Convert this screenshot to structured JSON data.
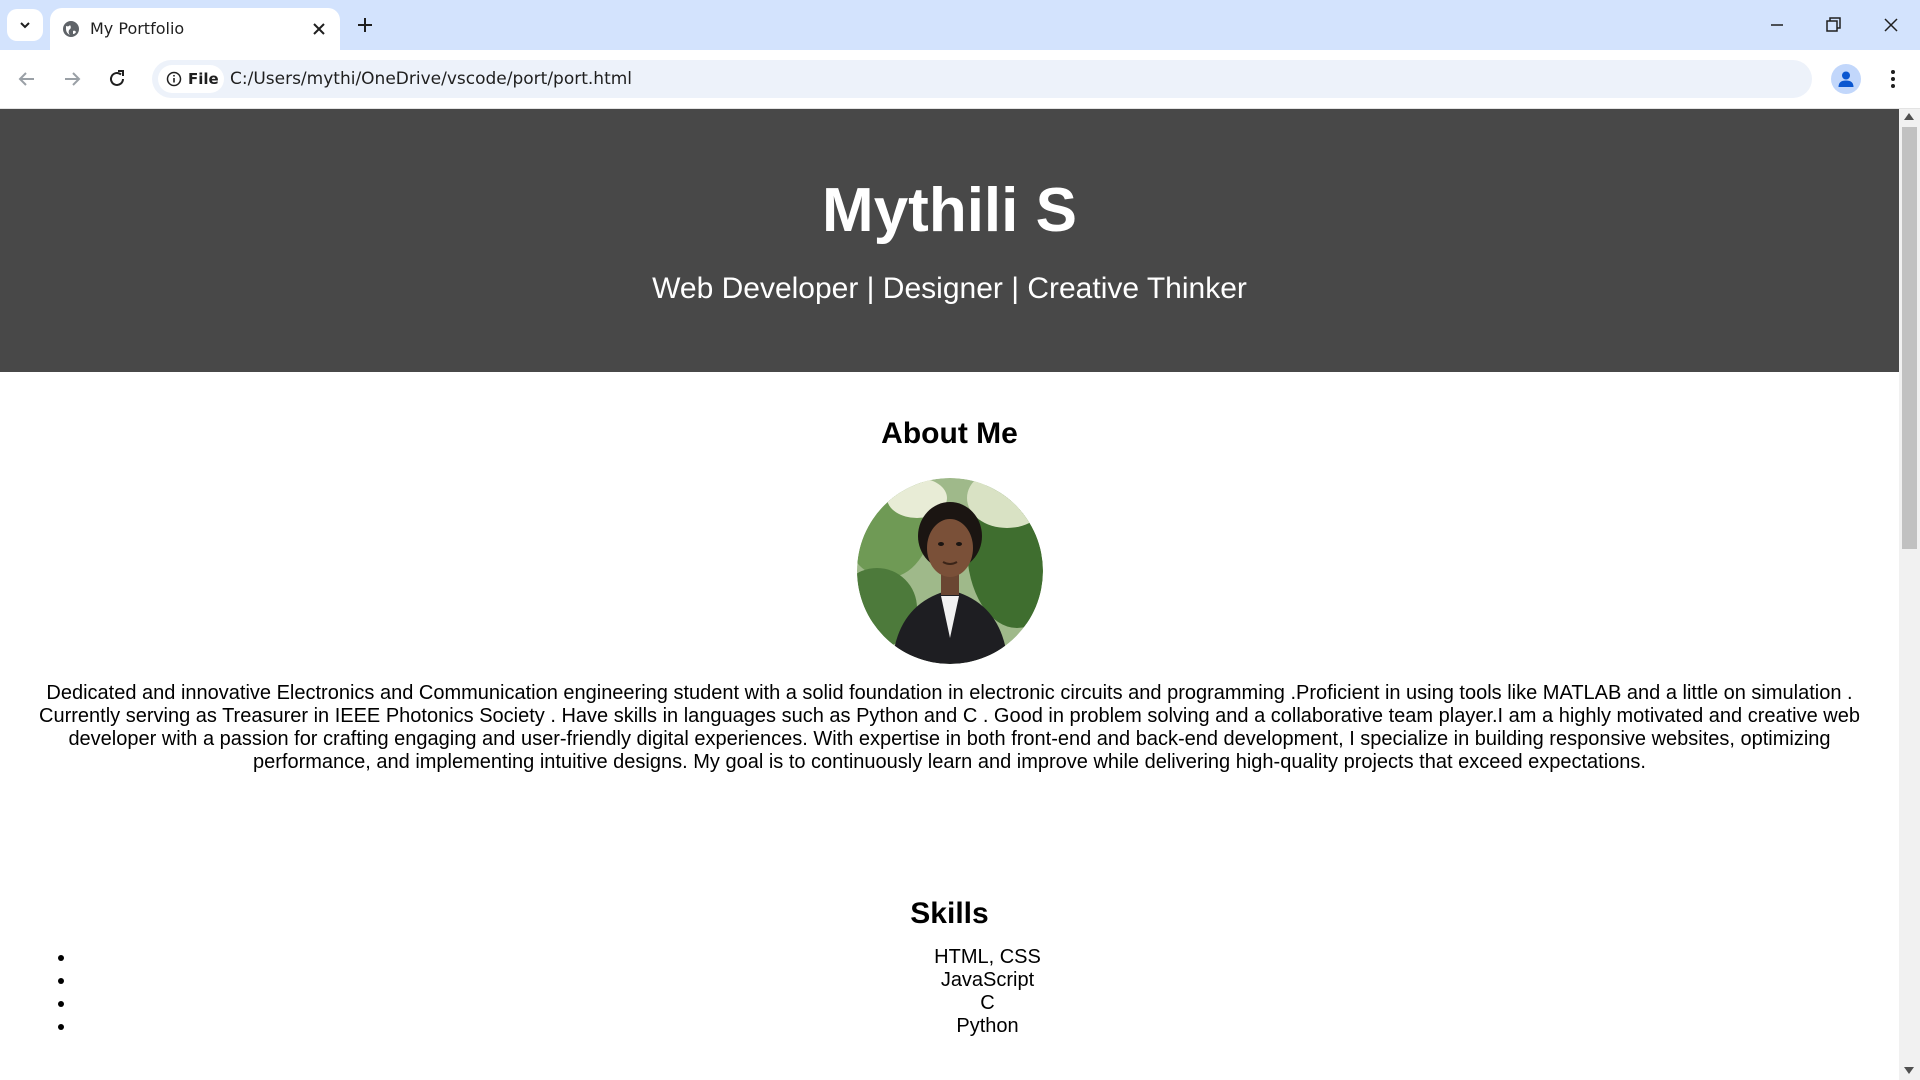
{
  "browser": {
    "tab_title": "My Portfolio",
    "site_chip_label": "File",
    "url": "C:/Users/mythi/OneDrive/vscode/port/port.html"
  },
  "page": {
    "name": "Mythili S",
    "tagline": "Web Developer | Designer | Creative Thinker",
    "about": {
      "heading": "About Me",
      "text": "Dedicated and innovative Electronics and Communication engineering student with a solid foundation in electronic circuits and programming .Proficient in using tools like MATLAB and a little on simulation . Currently serving as Treasurer in IEEE Photonics Society . Have skills in languages such as Python and C . Good in problem solving and a collaborative team player.I am a highly motivated and creative web developer with a passion for crafting engaging and user-friendly digital experiences. With expertise in both front-end and back-end development, I specialize in building responsive websites, optimizing performance, and implementing intuitive designs. My goal is to continuously learn and improve while delivering high-quality projects that exceed expectations."
    },
    "skills": {
      "heading": "Skills",
      "items": [
        "HTML, CSS",
        "JavaScript",
        "C",
        "Python"
      ]
    }
  },
  "colors": {
    "tabstrip": "#d3e3fd",
    "hero_bg": "#484848",
    "hero_text": "#ffffff"
  }
}
